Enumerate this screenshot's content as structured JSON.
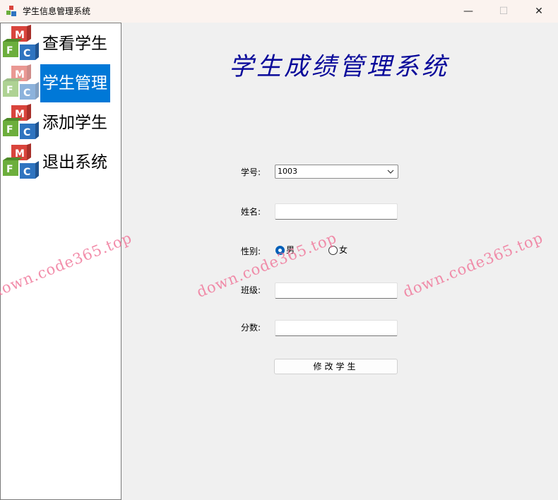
{
  "window": {
    "title": "学生信息管理系统",
    "minimize": "—",
    "maximize": "☐",
    "close": "✕"
  },
  "sidebar": {
    "items": [
      {
        "label": "查看学生",
        "icon": "mfc-cube-icon",
        "selected": false
      },
      {
        "label": "学生管理",
        "icon": "mfc-cube-icon",
        "selected": true
      },
      {
        "label": "添加学生",
        "icon": "mfc-cube-icon",
        "selected": false
      },
      {
        "label": "退出系统",
        "icon": "mfc-cube-icon",
        "selected": false
      }
    ]
  },
  "main": {
    "title": "学生成绩管理系统",
    "fields": {
      "student_id": {
        "label": "学号:",
        "value": "1003"
      },
      "name": {
        "label": "姓名:",
        "value": ""
      },
      "gender": {
        "label": "性别:",
        "options": [
          "男",
          "女"
        ],
        "selected": "男"
      },
      "class": {
        "label": "班级:",
        "value": ""
      },
      "score": {
        "label": "分数:",
        "value": ""
      }
    },
    "submit_label": "修改学生"
  },
  "watermark": {
    "text": "down.code365.top",
    "color": "#f07a9c"
  },
  "colors": {
    "selection": "#0078d7",
    "title": "#0a0a9a",
    "radio_checked": "#005fb8"
  }
}
